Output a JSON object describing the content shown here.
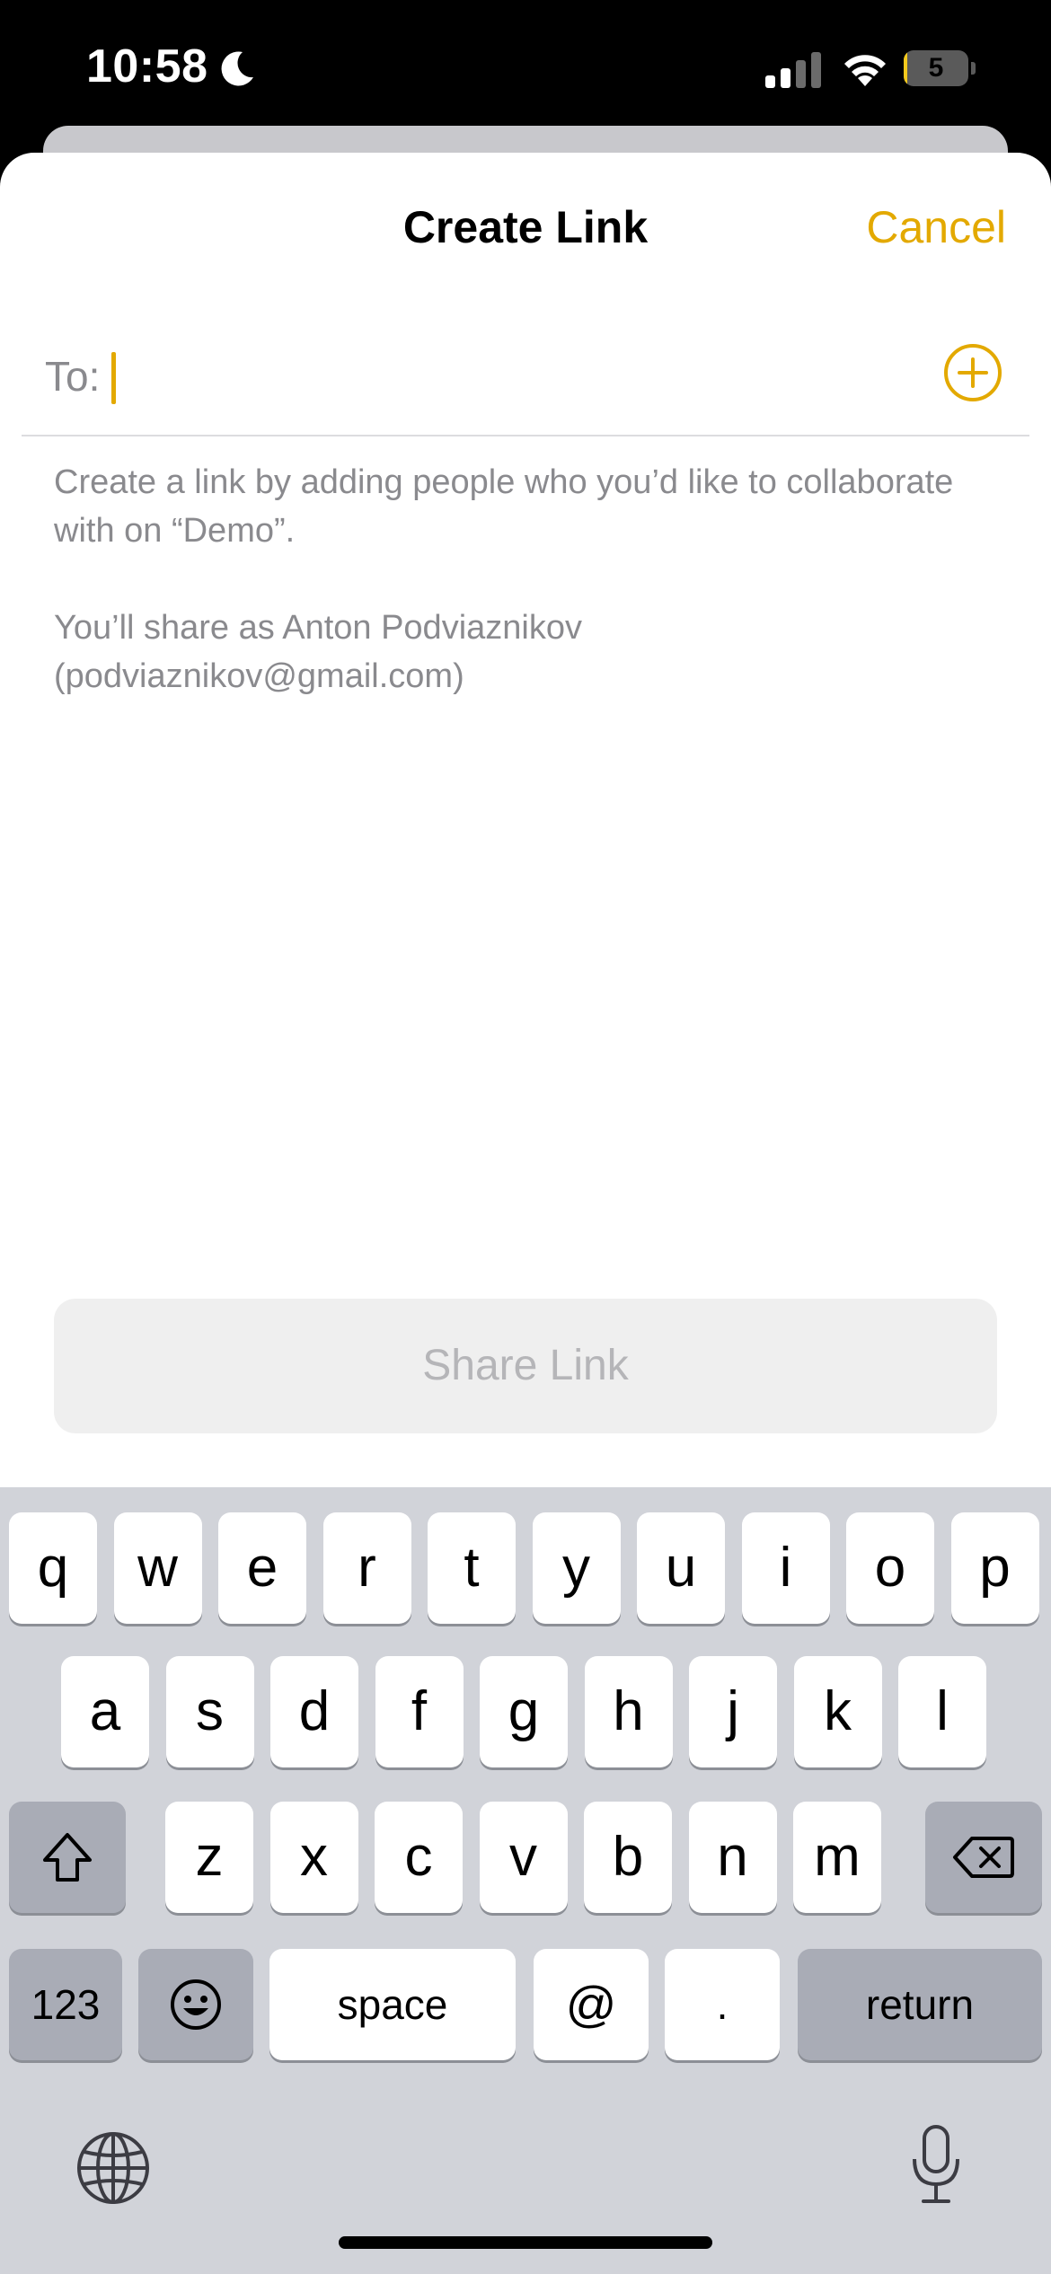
{
  "status_bar": {
    "time": "10:58",
    "battery_level": "5",
    "battery_fraction": 0.05,
    "icons": [
      "moon-icon",
      "signal-icon",
      "wifi-icon",
      "battery-icon"
    ]
  },
  "sheet": {
    "title": "Create Link",
    "cancel_label": "Cancel",
    "accent_color": "#e3a900"
  },
  "recipients": {
    "label": "To:",
    "value": "",
    "placeholder": "",
    "add_icon": "plus-circle-icon"
  },
  "description": {
    "line1": "Create a link by adding people who you’d like to collaborate with on “Demo”.",
    "line2": "You’ll share as Anton Podviaznikov (podviaznikov@gmail.com)"
  },
  "share_button": {
    "label": "Share Link",
    "enabled": false
  },
  "keyboard": {
    "row1": [
      "q",
      "w",
      "e",
      "r",
      "t",
      "y",
      "u",
      "i",
      "o",
      "p"
    ],
    "row2": [
      "a",
      "s",
      "d",
      "f",
      "g",
      "h",
      "j",
      "k",
      "l"
    ],
    "row3": [
      "z",
      "x",
      "c",
      "v",
      "b",
      "n",
      "m"
    ],
    "numbers_label": "123",
    "space_label": "space",
    "at_label": "@",
    "period_label": ".",
    "return_label": "return",
    "icons": [
      "shift-icon",
      "backspace-icon",
      "emoji-icon",
      "globe-icon",
      "microphone-icon"
    ]
  }
}
